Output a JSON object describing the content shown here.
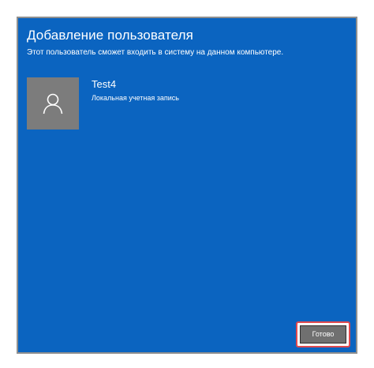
{
  "dialog": {
    "title": "Добавление пользователя",
    "subtitle": "Этот пользователь сможет входить в систему на данном компьютере.",
    "background_color": "#0b64c0"
  },
  "user": {
    "avatar_icon": "person-icon",
    "name": "Test4",
    "account_type": "Локальная учетная запись"
  },
  "actions": {
    "done_label": "Готово",
    "highlight_color": "#e04a4f"
  }
}
